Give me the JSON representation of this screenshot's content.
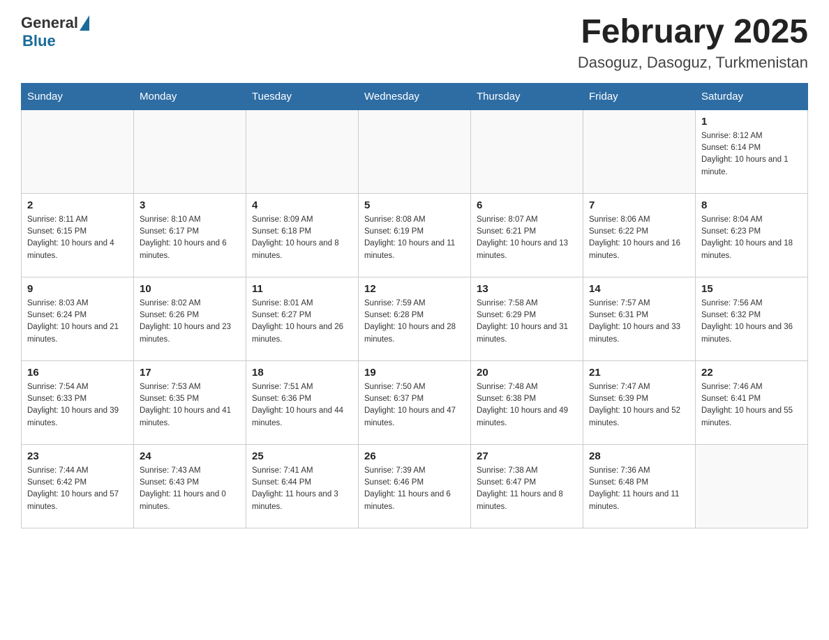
{
  "header": {
    "logo_general": "General",
    "logo_blue": "Blue",
    "month_title": "February 2025",
    "location": "Dasoguz, Dasoguz, Turkmenistan"
  },
  "days_of_week": [
    "Sunday",
    "Monday",
    "Tuesday",
    "Wednesday",
    "Thursday",
    "Friday",
    "Saturday"
  ],
  "weeks": [
    {
      "days": [
        {
          "number": "",
          "info": ""
        },
        {
          "number": "",
          "info": ""
        },
        {
          "number": "",
          "info": ""
        },
        {
          "number": "",
          "info": ""
        },
        {
          "number": "",
          "info": ""
        },
        {
          "number": "",
          "info": ""
        },
        {
          "number": "1",
          "info": "Sunrise: 8:12 AM\nSunset: 6:14 PM\nDaylight: 10 hours and 1 minute."
        }
      ]
    },
    {
      "days": [
        {
          "number": "2",
          "info": "Sunrise: 8:11 AM\nSunset: 6:15 PM\nDaylight: 10 hours and 4 minutes."
        },
        {
          "number": "3",
          "info": "Sunrise: 8:10 AM\nSunset: 6:17 PM\nDaylight: 10 hours and 6 minutes."
        },
        {
          "number": "4",
          "info": "Sunrise: 8:09 AM\nSunset: 6:18 PM\nDaylight: 10 hours and 8 minutes."
        },
        {
          "number": "5",
          "info": "Sunrise: 8:08 AM\nSunset: 6:19 PM\nDaylight: 10 hours and 11 minutes."
        },
        {
          "number": "6",
          "info": "Sunrise: 8:07 AM\nSunset: 6:21 PM\nDaylight: 10 hours and 13 minutes."
        },
        {
          "number": "7",
          "info": "Sunrise: 8:06 AM\nSunset: 6:22 PM\nDaylight: 10 hours and 16 minutes."
        },
        {
          "number": "8",
          "info": "Sunrise: 8:04 AM\nSunset: 6:23 PM\nDaylight: 10 hours and 18 minutes."
        }
      ]
    },
    {
      "days": [
        {
          "number": "9",
          "info": "Sunrise: 8:03 AM\nSunset: 6:24 PM\nDaylight: 10 hours and 21 minutes."
        },
        {
          "number": "10",
          "info": "Sunrise: 8:02 AM\nSunset: 6:26 PM\nDaylight: 10 hours and 23 minutes."
        },
        {
          "number": "11",
          "info": "Sunrise: 8:01 AM\nSunset: 6:27 PM\nDaylight: 10 hours and 26 minutes."
        },
        {
          "number": "12",
          "info": "Sunrise: 7:59 AM\nSunset: 6:28 PM\nDaylight: 10 hours and 28 minutes."
        },
        {
          "number": "13",
          "info": "Sunrise: 7:58 AM\nSunset: 6:29 PM\nDaylight: 10 hours and 31 minutes."
        },
        {
          "number": "14",
          "info": "Sunrise: 7:57 AM\nSunset: 6:31 PM\nDaylight: 10 hours and 33 minutes."
        },
        {
          "number": "15",
          "info": "Sunrise: 7:56 AM\nSunset: 6:32 PM\nDaylight: 10 hours and 36 minutes."
        }
      ]
    },
    {
      "days": [
        {
          "number": "16",
          "info": "Sunrise: 7:54 AM\nSunset: 6:33 PM\nDaylight: 10 hours and 39 minutes."
        },
        {
          "number": "17",
          "info": "Sunrise: 7:53 AM\nSunset: 6:35 PM\nDaylight: 10 hours and 41 minutes."
        },
        {
          "number": "18",
          "info": "Sunrise: 7:51 AM\nSunset: 6:36 PM\nDaylight: 10 hours and 44 minutes."
        },
        {
          "number": "19",
          "info": "Sunrise: 7:50 AM\nSunset: 6:37 PM\nDaylight: 10 hours and 47 minutes."
        },
        {
          "number": "20",
          "info": "Sunrise: 7:48 AM\nSunset: 6:38 PM\nDaylight: 10 hours and 49 minutes."
        },
        {
          "number": "21",
          "info": "Sunrise: 7:47 AM\nSunset: 6:39 PM\nDaylight: 10 hours and 52 minutes."
        },
        {
          "number": "22",
          "info": "Sunrise: 7:46 AM\nSunset: 6:41 PM\nDaylight: 10 hours and 55 minutes."
        }
      ]
    },
    {
      "days": [
        {
          "number": "23",
          "info": "Sunrise: 7:44 AM\nSunset: 6:42 PM\nDaylight: 10 hours and 57 minutes."
        },
        {
          "number": "24",
          "info": "Sunrise: 7:43 AM\nSunset: 6:43 PM\nDaylight: 11 hours and 0 minutes."
        },
        {
          "number": "25",
          "info": "Sunrise: 7:41 AM\nSunset: 6:44 PM\nDaylight: 11 hours and 3 minutes."
        },
        {
          "number": "26",
          "info": "Sunrise: 7:39 AM\nSunset: 6:46 PM\nDaylight: 11 hours and 6 minutes."
        },
        {
          "number": "27",
          "info": "Sunrise: 7:38 AM\nSunset: 6:47 PM\nDaylight: 11 hours and 8 minutes."
        },
        {
          "number": "28",
          "info": "Sunrise: 7:36 AM\nSunset: 6:48 PM\nDaylight: 11 hours and 11 minutes."
        },
        {
          "number": "",
          "info": ""
        }
      ]
    }
  ]
}
